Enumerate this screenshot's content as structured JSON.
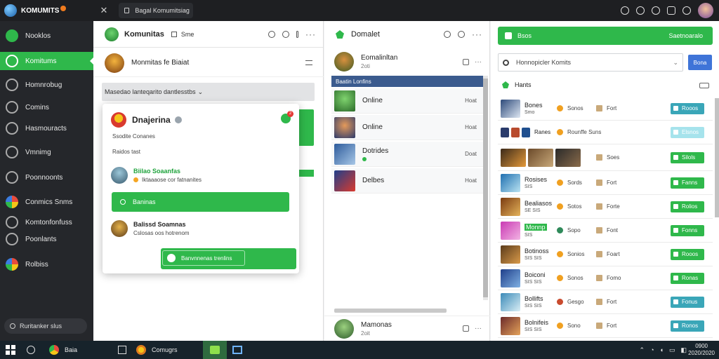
{
  "window": {
    "title": "KOMUMITS",
    "tab": "Bagal Komumitsiag"
  },
  "sidebar": {
    "items": [
      {
        "label": "Nooklos"
      },
      {
        "label": "Komitums"
      },
      {
        "label": "Homnrobug"
      },
      {
        "label": "Comins"
      },
      {
        "label": "Hasmouracts"
      },
      {
        "label": "Vmnimg"
      },
      {
        "label": "Poonnoonts"
      },
      {
        "label": "Conmics Snms"
      },
      {
        "label": "Komtonfonfuss"
      },
      {
        "label": "Poonlants"
      },
      {
        "label": "Rolbiss"
      }
    ],
    "search_placeholder": "Ruritanker slus"
  },
  "panel1": {
    "title": "Komunitas",
    "subtitle": "Sme",
    "chat_name": "Monmitas fe Biaiat",
    "filter": "Masedao lanteqarito dantlesstbs",
    "popup": {
      "name": "Dnajerina",
      "notif_count": "2",
      "line1": "Ssodite Conanes",
      "line2": "Raidos tast",
      "user1_name": "Biilao Soaanfas",
      "user1_status": "Iktaaaose cor fatnanites",
      "button1": "Baninas",
      "user2_name": "Balissd Soamnas",
      "user2_status": "Cslosas oos hotrenom",
      "button2": "Banvnnenas trenlins"
    }
  },
  "panel2": {
    "title": "Domalet",
    "top_name": "Eomalinltan",
    "top_sub": "2oti",
    "banner": "Baatin Lonfins",
    "items": [
      {
        "name": "Online",
        "right": "Hoat",
        "online": false
      },
      {
        "name": "Online",
        "right": "Hoat",
        "online": false
      },
      {
        "name": "Dotrides",
        "right": "Doat",
        "online": true
      },
      {
        "name": "Delbes",
        "right": "Hoat",
        "online": false
      }
    ],
    "bottom_name": "Mamonas",
    "bottom_sub": "2oit"
  },
  "panel3": {
    "top_bar": "Bsos",
    "top_bar_right": "Saetnoaralo",
    "search_placeholder": "Honnopicler Komits",
    "search_button": "Bona",
    "list_title": "Hants",
    "rows": [
      {
        "name": "Bones",
        "sub": "Smo",
        "cat": "Sonos",
        "mode": "Fort",
        "action": "Rooos",
        "style": "blue"
      },
      {
        "name": "Ranes",
        "sub": "",
        "cat": "Rounffe Suns",
        "mode": "",
        "action": "Elsnos",
        "style": "faded"
      },
      {
        "name": "",
        "sub": "",
        "cat": "",
        "mode": "Soes",
        "action": "Silols",
        "style": "green"
      },
      {
        "name": "Rosises",
        "sub": "SIS",
        "cat": "Sords",
        "mode": "Fort",
        "action": "Fanns",
        "style": "green"
      },
      {
        "name": "Bealiasos",
        "sub": "SE SIS",
        "cat": "Sotos",
        "mode": "Forte",
        "action": "Rolios",
        "style": "green"
      },
      {
        "name": "Monnp",
        "sub": "SIS",
        "cat": "Sopo",
        "mode": "Font",
        "action": "Fonns",
        "style": "green"
      },
      {
        "name": "Botinoss",
        "sub": "SIS SIS",
        "cat": "Sonios",
        "mode": "Foart",
        "action": "Rooos",
        "style": "green"
      },
      {
        "name": "Boiconi",
        "sub": "SIS SIS",
        "cat": "Sonos",
        "mode": "Fomo",
        "action": "Ronas",
        "style": "green"
      },
      {
        "name": "Bollifts",
        "sub": "SIS SIS",
        "cat": "Gesgo",
        "mode": "Fort",
        "action": "Fonus",
        "style": "blue"
      },
      {
        "name": "Bolnifeis",
        "sub": "SIS SIS",
        "cat": "Sono",
        "mode": "Fort",
        "action": "Ronos",
        "style": "blue"
      }
    ]
  },
  "taskbar": {
    "app1": "Baia",
    "app2": "Comugrs",
    "time": "0900",
    "date": "2020/2020"
  }
}
